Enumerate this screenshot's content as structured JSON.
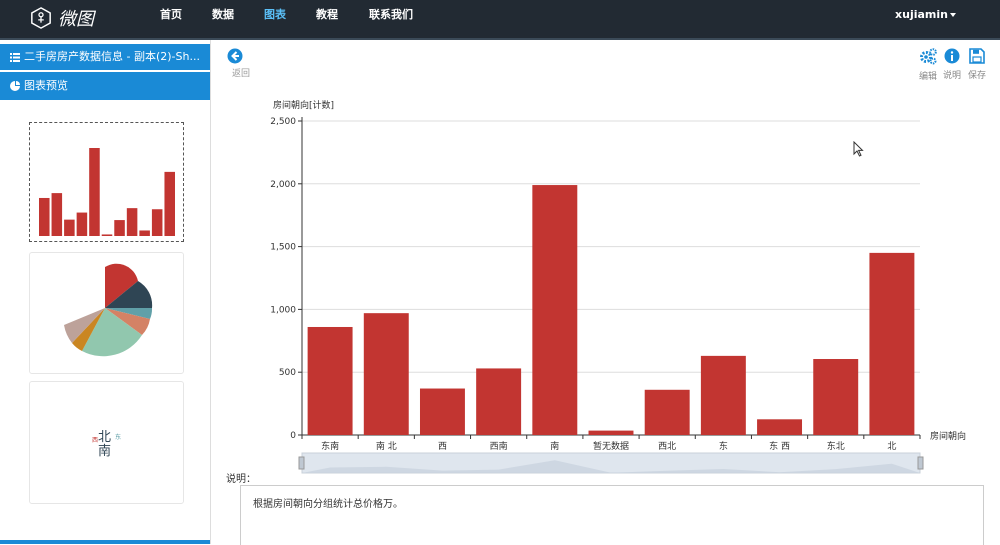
{
  "nav": {
    "logo_text": "微图",
    "items": [
      {
        "label": "首页",
        "active": false
      },
      {
        "label": "数据",
        "active": false
      },
      {
        "label": "图表",
        "active": true
      },
      {
        "label": "教程",
        "active": false
      },
      {
        "label": "联系我们",
        "active": false
      }
    ],
    "user": "xujiamin"
  },
  "sidebar": {
    "dataset_title": "二手房房产数据信息 - 副本(2)-Sh...",
    "preview_label": "图表预览",
    "thumbnails": [
      {
        "name": "bar",
        "selected": true
      },
      {
        "name": "pie",
        "selected": false
      },
      {
        "name": "wordcloud",
        "selected": false,
        "words": [
          "北",
          "南",
          "东",
          "西"
        ]
      }
    ]
  },
  "toolbar": {
    "back_label": "返回",
    "edit_label": "编辑",
    "info_label": "说明",
    "save_label": "保存"
  },
  "colors": {
    "bar": "#c23531",
    "nav_bg": "#222a33",
    "accent": "#1a8ad6"
  },
  "chart_data": {
    "type": "bar",
    "ylabel": "房间朝向[计数]",
    "xlabel": "房间朝向",
    "ylim": [
      0,
      2500
    ],
    "yticks": [
      "0",
      "500",
      "1,000",
      "1,500",
      "2,000",
      "2,500"
    ],
    "categories": [
      "东南",
      "南 北",
      "西",
      "西南",
      "南",
      "暂无数据",
      "西北",
      "东",
      "东 西",
      "东北",
      "北"
    ],
    "values": [
      860,
      970,
      370,
      530,
      1990,
      35,
      360,
      630,
      125,
      605,
      1450
    ],
    "grid": true,
    "data_zoom": true
  },
  "description": {
    "title": "说明：",
    "text": "根据房间朝向分组统计总价格万。"
  }
}
